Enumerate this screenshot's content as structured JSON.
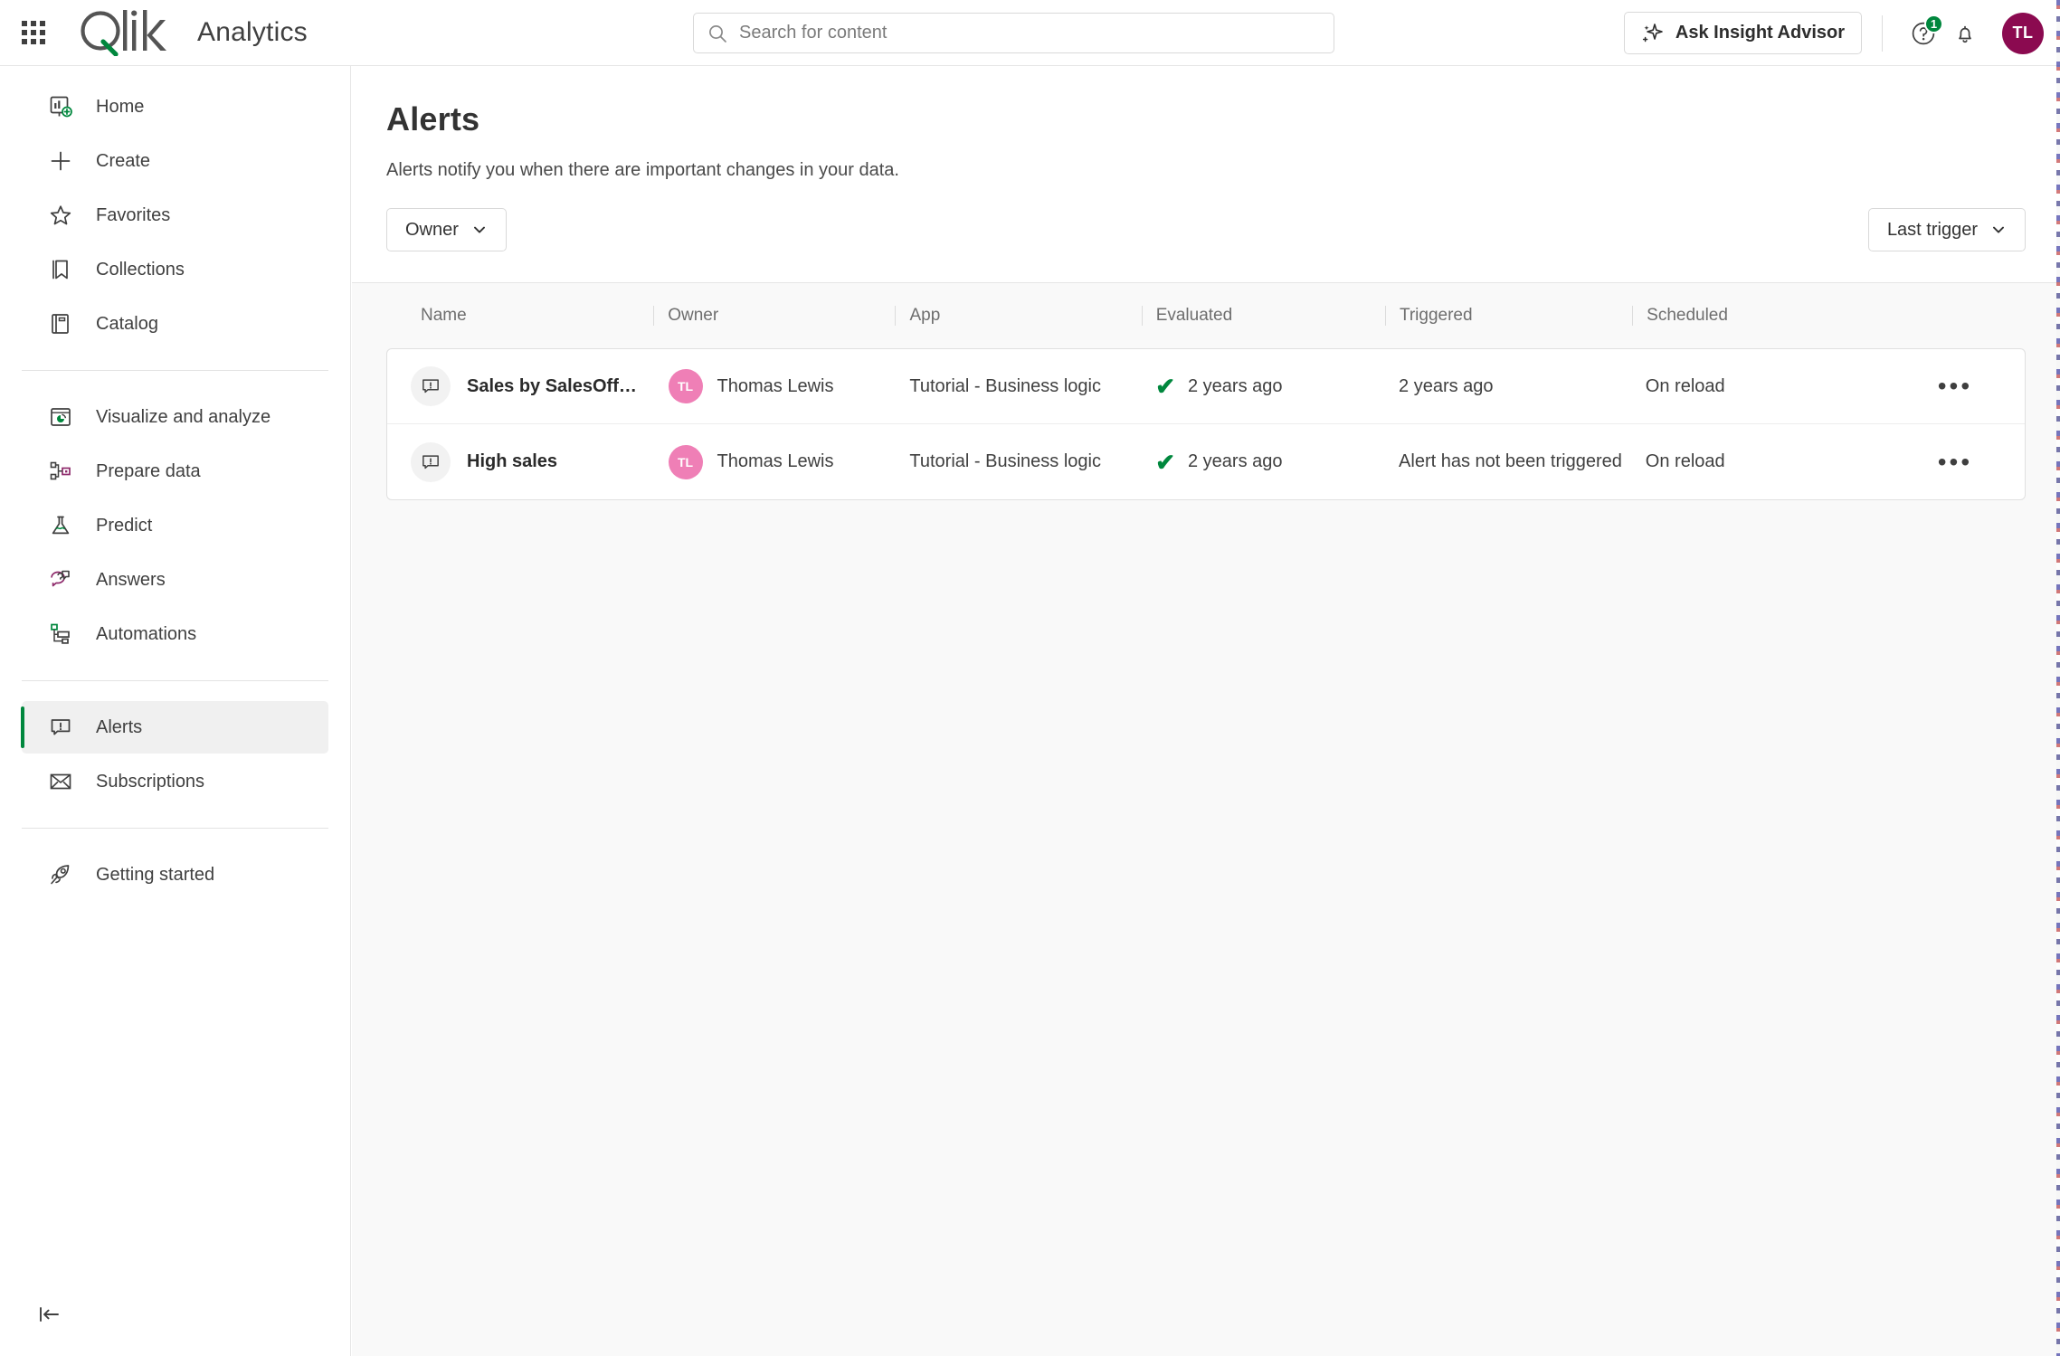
{
  "header": {
    "app_launcher": "app-launcher",
    "brand": "Analytics",
    "search": {
      "placeholder": "Search for content",
      "value": ""
    },
    "insight_advisor": "Ask Insight Advisor",
    "help_badge": "1",
    "avatar_initials": "TL",
    "accent_green": "#00873d",
    "avatar_color": "#8b0a50"
  },
  "sidebar": {
    "groups": [
      {
        "items": [
          {
            "label": "Home",
            "icon": "home-dashboard-icon",
            "active": false
          },
          {
            "label": "Create",
            "icon": "plus-icon",
            "active": false
          },
          {
            "label": "Favorites",
            "icon": "star-icon",
            "active": false
          },
          {
            "label": "Collections",
            "icon": "bookmark-icon",
            "active": false
          },
          {
            "label": "Catalog",
            "icon": "book-icon",
            "active": false
          }
        ]
      },
      {
        "items": [
          {
            "label": "Visualize and analyze",
            "icon": "chart-window-icon",
            "active": false
          },
          {
            "label": "Prepare data",
            "icon": "data-nodes-icon",
            "active": false
          },
          {
            "label": "Predict",
            "icon": "flask-icon",
            "active": false
          },
          {
            "label": "Answers",
            "icon": "chat-bulb-icon",
            "active": false
          },
          {
            "label": "Automations",
            "icon": "automation-flow-icon",
            "active": false
          }
        ]
      },
      {
        "items": [
          {
            "label": "Alerts",
            "icon": "alert-bubble-icon",
            "active": true
          },
          {
            "label": "Subscriptions",
            "icon": "envelope-icon",
            "active": false
          }
        ]
      },
      {
        "items": [
          {
            "label": "Getting started",
            "icon": "rocket-icon",
            "active": false
          }
        ]
      }
    ],
    "collapse": "collapse-sidebar"
  },
  "main": {
    "title": "Alerts",
    "subtitle": "Alerts notify you when there are important changes in your data.",
    "filters": {
      "owner": "Owner",
      "sort": "Last trigger"
    },
    "table": {
      "columns": [
        "Name",
        "Owner",
        "App",
        "Evaluated",
        "Triggered",
        "Scheduled"
      ],
      "rows": [
        {
          "name": "Sales by SalesOff…",
          "owner": "Thomas Lewis",
          "owner_initials": "TL",
          "app": "Tutorial - Business logic",
          "evaluated": "2 years ago",
          "evaluated_ok": true,
          "triggered": "2 years ago",
          "scheduled": "On reload",
          "menu": "•••"
        },
        {
          "name": "High sales",
          "owner": "Thomas Lewis",
          "owner_initials": "TL",
          "app": "Tutorial - Business logic",
          "evaluated": "2 years ago",
          "evaluated_ok": true,
          "triggered": "Alert has not been triggered",
          "scheduled": "On reload",
          "menu": "•••"
        }
      ]
    }
  }
}
